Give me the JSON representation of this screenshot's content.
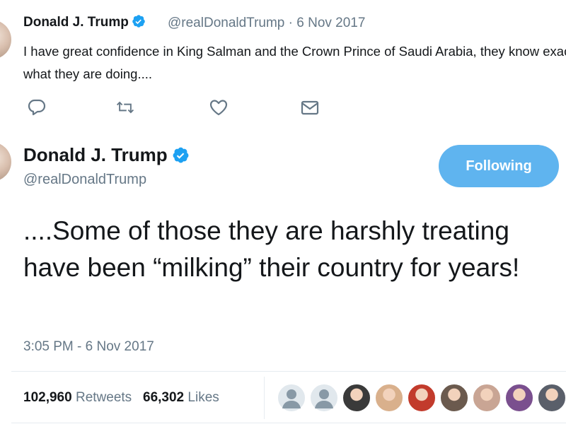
{
  "tweet1": {
    "author_name": "Donald J. Trump",
    "meta": "@realDonaldTrump · 6 Nov 2017",
    "text": "I have great confidence in King Salman and the Crown Prince of Saudi Arabia, they know exactly what they are doing...."
  },
  "actions": {
    "reply_icon": "speech-bubble",
    "retweet_icon": "retweet-arrows",
    "like_icon": "heart-outline",
    "dm_icon": "envelope"
  },
  "tweet2": {
    "author_name": "Donald J. Trump",
    "handle": "@realDonaldTrump",
    "follow_label": "Following",
    "text": "....Some of those they are harshly treating have been “milking” their country for years!",
    "timestamp": "3:05 PM - 6 Nov 2017",
    "retweets_count": "102,960",
    "retweets_label": "Retweets",
    "likes_count": "66,302",
    "likes_label": "Likes"
  },
  "colors": {
    "accent": "#1da1f2",
    "follow_button": "#5fb4ef",
    "secondary_text": "#657786",
    "divider": "#e6ecf0"
  },
  "likers": [
    {
      "type": "default",
      "color": "#8899a6"
    },
    {
      "type": "default",
      "color": "#8899a6"
    },
    {
      "type": "photo",
      "color": "#3a3a3a"
    },
    {
      "type": "photo",
      "color": "#d9b08c"
    },
    {
      "type": "photo",
      "color": "#c23b2c"
    },
    {
      "type": "photo",
      "color": "#6b5a4e"
    },
    {
      "type": "photo",
      "color": "#c9a594"
    },
    {
      "type": "photo",
      "color": "#7a4f8e"
    },
    {
      "type": "photo",
      "color": "#5a5f6a"
    }
  ]
}
